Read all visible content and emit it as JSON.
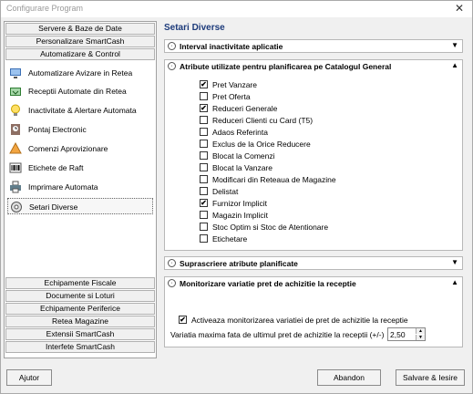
{
  "window": {
    "title": "Configurare Program",
    "close": "✕"
  },
  "sections_top": [
    "Servere & Baze de Date",
    "Personalizare SmartCash",
    "Automatizare & Control"
  ],
  "nav_items": [
    {
      "label": "Automatizare Avizare in Retea",
      "icon": "network-icon"
    },
    {
      "label": "Receptii Automate din Retea",
      "icon": "receive-icon"
    },
    {
      "label": "Inactivitate & Alertare Automata",
      "icon": "lightbulb-icon"
    },
    {
      "label": "Pontaj Electronic",
      "icon": "clock-icon"
    },
    {
      "label": "Comenzi Aprovizionare",
      "icon": "order-icon"
    },
    {
      "label": "Etichete de Raft",
      "icon": "barcode-icon"
    },
    {
      "label": "Imprimare Automata",
      "icon": "printer-icon"
    },
    {
      "label": "Setari Diverse",
      "icon": "settings-icon"
    }
  ],
  "sections_bottom": [
    "Echipamente Fiscale",
    "Documente si Loturi",
    "Echipamente Periferice",
    "Retea Magazine",
    "Extensii SmartCash",
    "Interfete SmartCash"
  ],
  "panel": {
    "title": "Setari Diverse",
    "group1": {
      "title": "Interval inactivitate aplicatie",
      "arrow": "▼"
    },
    "group2": {
      "title": "Atribute utilizate pentru planificarea pe Catalogul General",
      "arrow": "▲",
      "items": [
        {
          "label": "Pret Vanzare",
          "checked": "✔"
        },
        {
          "label": "Pret Oferta",
          "checked": ""
        },
        {
          "label": "Reduceri Generale",
          "checked": "✔"
        },
        {
          "label": "Reduceri Clienti cu Card (T5)",
          "checked": ""
        },
        {
          "label": "Adaos Referinta",
          "checked": ""
        },
        {
          "label": "Exclus de la Orice Reducere",
          "checked": ""
        },
        {
          "label": "Blocat la Comenzi",
          "checked": ""
        },
        {
          "label": "Blocat la Vanzare",
          "checked": ""
        },
        {
          "label": "Modificari din Reteaua de Magazine",
          "checked": ""
        },
        {
          "label": "Delistat",
          "checked": ""
        },
        {
          "label": "Furnizor Implicit",
          "checked": "✔"
        },
        {
          "label": "Magazin Implicit",
          "checked": ""
        },
        {
          "label": "Stoc Optim si Stoc de Atentionare",
          "checked": ""
        },
        {
          "label": "Etichetare",
          "checked": ""
        }
      ]
    },
    "group3": {
      "title": "Suprascriere atribute planificate",
      "arrow": "▼"
    },
    "group4": {
      "title": "Monitorizare variatie pret de achizitie la receptie",
      "arrow": "▲",
      "checkbox_label": "Activeaza monitorizarea variatiei de pret de achizitie la receptie",
      "checkbox_checked": "✔",
      "variation_label": "Variatia maxima fata de ultimul pret de achizitie la receptii (+/-)",
      "variation_value": "2,50"
    }
  },
  "buttons": {
    "help": "Ajutor",
    "cancel": "Abandon",
    "save": "Salvare & Iesire"
  }
}
